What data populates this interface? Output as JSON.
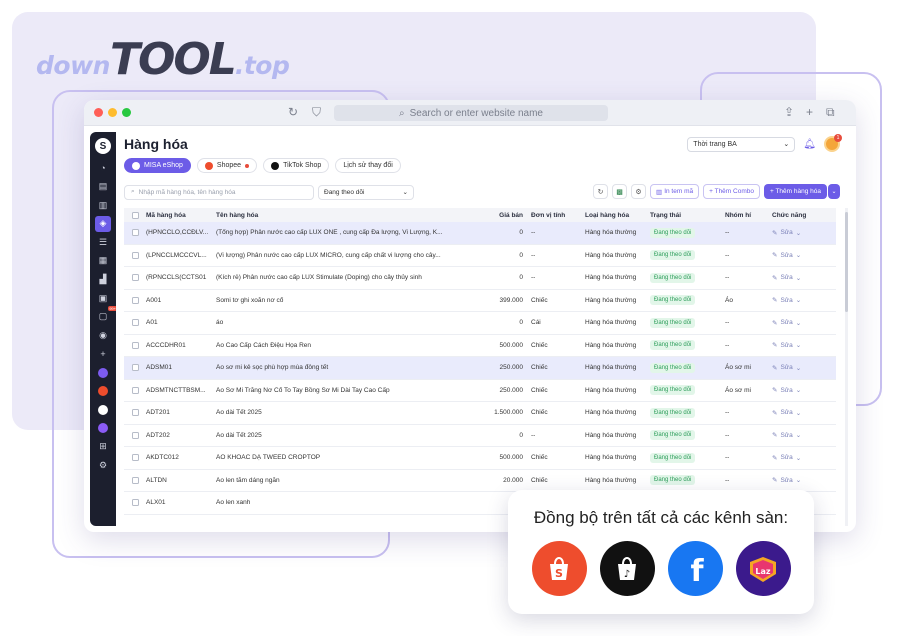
{
  "brand": {
    "down": "down",
    "tool": "TOOL",
    "top": ".top"
  },
  "browser": {
    "url_placeholder": "Search or enter website name"
  },
  "colors": {
    "accent": "#6c5ce7",
    "status_green": "#2e9e5b",
    "shopee": "#ee4d2d",
    "facebook": "#1877f2",
    "lazada": "#3b1a8c"
  },
  "page": {
    "title": "Hàng hóa",
    "status_select": "Thời trang BA",
    "notification_count": "1",
    "tabs": [
      {
        "label": "MISA eShop",
        "icon": "misa-icon"
      },
      {
        "label": "Shopee",
        "icon": "shopee-icon"
      },
      {
        "label": "TikTok Shop",
        "icon": "tiktok-icon"
      },
      {
        "label": "Lịch sử thay đổi",
        "icon": ""
      }
    ],
    "search_placeholder": "Nhập mã hàng hóa, tên hàng hóa",
    "filter_value": "Đang theo dõi",
    "btn_print": "In tem mã",
    "btn_combo": "+ Thêm Combo",
    "btn_add": "+ Thêm hàng hóa"
  },
  "sidebar": {
    "items": [
      "dashboard-icon",
      "orders-icon",
      "document-icon",
      "product-icon",
      "list-icon",
      "grid-icon",
      "report-icon",
      "store-icon",
      "chat-icon",
      "broadcast-icon",
      "plus-icon",
      "channel-icon",
      "shopee-icon",
      "tiktok-icon",
      "integration-icon",
      "apps-icon",
      "settings-icon"
    ],
    "chat_badge": "99+"
  },
  "table": {
    "headers": {
      "code": "Mã hàng hóa",
      "name": "Tên hàng hóa",
      "price": "Giá bán",
      "unit": "Đơn vị tính",
      "type": "Loại hàng hóa",
      "status": "Trạng thái",
      "group": "Nhóm hí",
      "func": "Chức năng"
    },
    "edit_label": "Sửa",
    "rows": [
      {
        "code": "(HPNCCLO,CCĐLV...",
        "name": "(Tổng hợp) Phân nước cao cấp LUX ONE , cung cấp Đa lượng, Vi Lượng, K...",
        "price": "0",
        "unit": "--",
        "type": "Hàng hóa thường",
        "status": "Đang theo dõi",
        "group": "--"
      },
      {
        "code": "(LPNCCLMCCCVL...",
        "name": "(Vi lượng) Phân nước cao cấp LUX MICRO, cung cấp chất vi lượng cho cây...",
        "price": "0",
        "unit": "--",
        "type": "Hàng hóa thường",
        "status": "Đang theo dõi",
        "group": "--"
      },
      {
        "code": "(RPNCCLS(CCTS01",
        "name": "(Kích rễ) Phân nước cao cấp LUX Stimulate (Doping) cho cây thủy sinh",
        "price": "0",
        "unit": "--",
        "type": "Hàng hóa thường",
        "status": "Đang theo dõi",
        "group": "--"
      },
      {
        "code": "A001",
        "name": "Somi tơ ghi xoắn nơ cổ",
        "price": "399.000",
        "unit": "Chiếc",
        "type": "Hàng hóa thường",
        "status": "Đang theo dõi",
        "group": "Áo"
      },
      {
        "code": "A01",
        "name": "áo",
        "price": "0",
        "unit": "Cái",
        "type": "Hàng hóa thường",
        "status": "Đang theo dõi",
        "group": "--"
      },
      {
        "code": "ACCCDHR01",
        "name": "Áo Cao Cấp Cách Điệu Họa Ren",
        "price": "500.000",
        "unit": "Chiếc",
        "type": "Hàng hóa thường",
        "status": "Đang theo dõi",
        "group": "--"
      },
      {
        "code": "ADSM01",
        "name": "Áo sơ mi kẻ sọc phù hợp mùa đông tết",
        "price": "250.000",
        "unit": "Chiếc",
        "type": "Hàng hóa thường",
        "status": "Đang theo dõi",
        "group": "Áo sơ mi"
      },
      {
        "code": "ADSMTNCTTBSM...",
        "name": "Áo Sơ Mi Trắng Nơ Cổ To Tay Bồng Sơ Mi Dài Tay Cao Cấp",
        "price": "250.000",
        "unit": "Chiếc",
        "type": "Hàng hóa thường",
        "status": "Đang theo dõi",
        "group": "Áo sơ mi"
      },
      {
        "code": "ADT201",
        "name": "Áo dài Tết 2025",
        "price": "1.500.000",
        "unit": "Chiếc",
        "type": "Hàng hóa thường",
        "status": "Đang theo dõi",
        "group": "--"
      },
      {
        "code": "ADT202",
        "name": "Áo dài Tết 2025",
        "price": "0",
        "unit": "--",
        "type": "Hàng hóa thường",
        "status": "Đang theo dõi",
        "group": "--"
      },
      {
        "code": "AKDTC012",
        "name": "ÁO KHOÁC DẠ TWEED CROPTOP",
        "price": "500.000",
        "unit": "Chiếc",
        "type": "Hàng hóa thường",
        "status": "Đang theo dõi",
        "group": "--"
      },
      {
        "code": "ALTDN",
        "name": "Áo len tăm dáng ngắn",
        "price": "20.000",
        "unit": "Chiếc",
        "type": "Hàng hóa thường",
        "status": "Đang theo dõi",
        "group": "--"
      },
      {
        "code": "ALX01",
        "name": "Áo len xanh",
        "price": "",
        "unit": "",
        "type": "",
        "status": "",
        "group": ""
      }
    ]
  },
  "sync": {
    "title": "Đồng bộ trên tất cả các kênh sàn:",
    "channels": [
      "shopee-icon",
      "tiktok-icon",
      "facebook-icon",
      "lazada-icon"
    ],
    "lazada_text": "Laz"
  }
}
